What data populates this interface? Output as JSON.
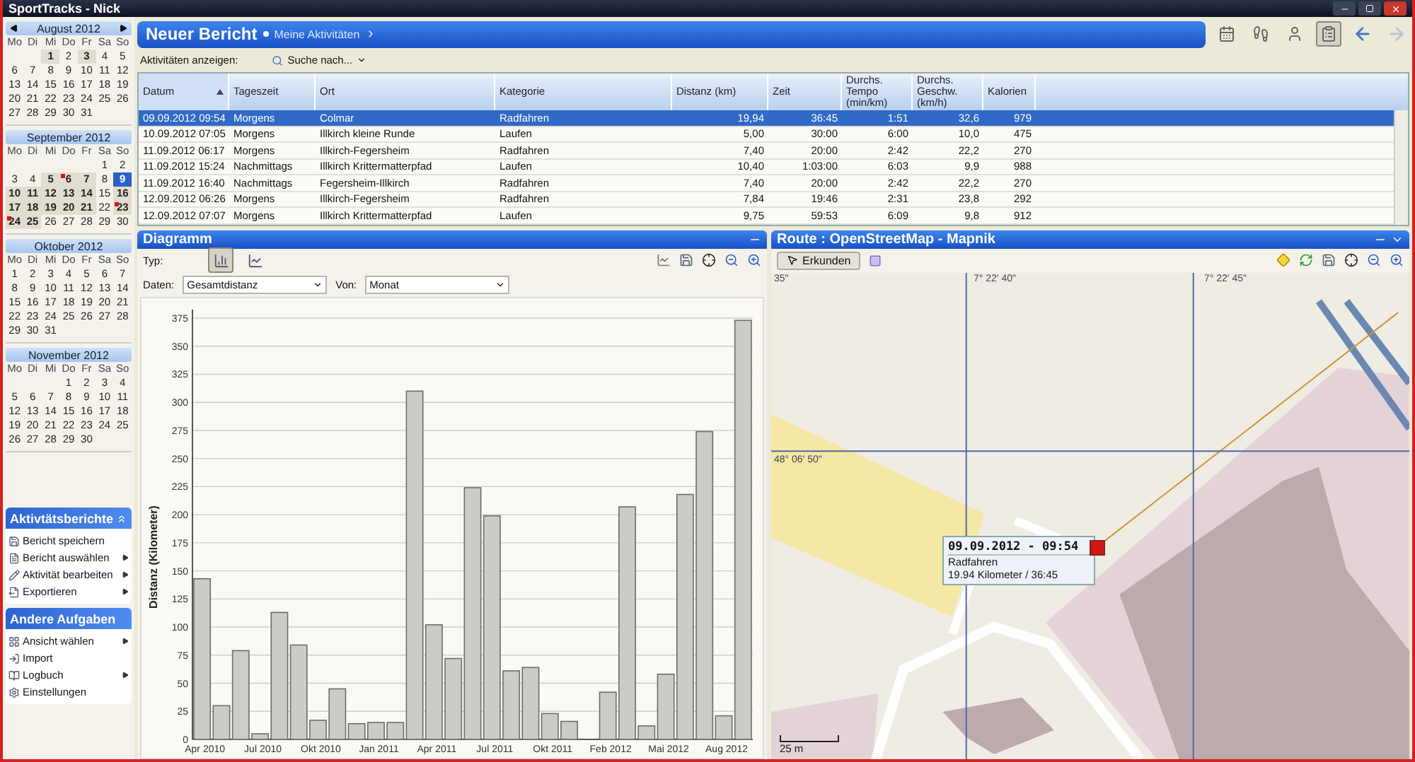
{
  "window": {
    "title": "SportTracks - Nick"
  },
  "calendars": [
    {
      "title": "August 2012",
      "nav_arrows": true,
      "weekdays": [
        "Mo",
        "Di",
        "Mi",
        "Do",
        "Fr",
        "Sa",
        "So"
      ],
      "cells": [
        {
          "kind": "blank"
        },
        {
          "kind": "blank"
        },
        {
          "kind": "day",
          "day": "1",
          "has_activity": true,
          "selected": false,
          "flagged": false
        },
        {
          "kind": "day",
          "day": "2",
          "has_activity": false,
          "selected": false,
          "flagged": false
        },
        {
          "kind": "day",
          "day": "3",
          "has_activity": true,
          "selected": false,
          "flagged": false
        },
        {
          "kind": "day",
          "day": "4",
          "has_activity": false,
          "selected": false,
          "flagged": false
        },
        {
          "kind": "day",
          "day": "5",
          "has_activity": false,
          "selected": false,
          "flagged": false
        },
        {
          "kind": "day",
          "day": "6",
          "has_activity": false,
          "selected": false,
          "flagged": false
        },
        {
          "kind": "day",
          "day": "7",
          "has_activity": false,
          "selected": false,
          "flagged": false
        },
        {
          "kind": "day",
          "day": "8",
          "has_activity": false,
          "selected": false,
          "flagged": false
        },
        {
          "kind": "day",
          "day": "9",
          "has_activity": false,
          "selected": false,
          "flagged": false
        },
        {
          "kind": "day",
          "day": "10",
          "has_activity": false,
          "selected": false,
          "flagged": false
        },
        {
          "kind": "day",
          "day": "11",
          "has_activity": false,
          "selected": false,
          "flagged": false
        },
        {
          "kind": "day",
          "day": "12",
          "has_activity": false,
          "selected": false,
          "flagged": false
        },
        {
          "kind": "day",
          "day": "13",
          "has_activity": false,
          "selected": false,
          "flagged": false
        },
        {
          "kind": "day",
          "day": "14",
          "has_activity": false,
          "selected": false,
          "flagged": false
        },
        {
          "kind": "day",
          "day": "15",
          "has_activity": false,
          "selected": false,
          "flagged": false
        },
        {
          "kind": "day",
          "day": "16",
          "has_activity": false,
          "selected": false,
          "flagged": false
        },
        {
          "kind": "day",
          "day": "17",
          "has_activity": false,
          "selected": false,
          "flagged": false
        },
        {
          "kind": "day",
          "day": "18",
          "has_activity": false,
          "selected": false,
          "flagged": false
        },
        {
          "kind": "day",
          "day": "19",
          "has_activity": false,
          "selected": false,
          "flagged": false
        },
        {
          "kind": "day",
          "day": "20",
          "has_activity": false,
          "selected": false,
          "flagged": false
        },
        {
          "kind": "day",
          "day": "21",
          "has_activity": false,
          "selected": false,
          "flagged": false
        },
        {
          "kind": "day",
          "day": "22",
          "has_activity": false,
          "selected": false,
          "flagged": false
        },
        {
          "kind": "day",
          "day": "23",
          "has_activity": false,
          "selected": false,
          "flagged": false
        },
        {
          "kind": "day",
          "day": "24",
          "has_activity": false,
          "selected": false,
          "flagged": false
        },
        {
          "kind": "day",
          "day": "25",
          "has_activity": false,
          "selected": false,
          "flagged": false
        },
        {
          "kind": "day",
          "day": "26",
          "has_activity": false,
          "selected": false,
          "flagged": false
        },
        {
          "kind": "day",
          "day": "27",
          "has_activity": false,
          "selected": false,
          "flagged": false
        },
        {
          "kind": "day",
          "day": "28",
          "has_activity": false,
          "selected": false,
          "flagged": false
        },
        {
          "kind": "day",
          "day": "29",
          "has_activity": false,
          "selected": false,
          "flagged": false
        },
        {
          "kind": "day",
          "day": "30",
          "has_activity": false,
          "selected": false,
          "flagged": false
        },
        {
          "kind": "day",
          "day": "31",
          "has_activity": false,
          "selected": false,
          "flagged": false
        }
      ]
    },
    {
      "title": "September 2012",
      "nav_arrows": false,
      "weekdays": [
        "Mo",
        "Di",
        "Mi",
        "Do",
        "Fr",
        "Sa",
        "So"
      ],
      "cells": [
        {
          "kind": "blank"
        },
        {
          "kind": "blank"
        },
        {
          "kind": "blank"
        },
        {
          "kind": "blank"
        },
        {
          "kind": "blank"
        },
        {
          "kind": "day",
          "day": "1",
          "has_activity": false,
          "selected": false,
          "flagged": false
        },
        {
          "kind": "day",
          "day": "2",
          "has_activity": false,
          "selected": false,
          "flagged": false
        },
        {
          "kind": "day",
          "day": "3",
          "has_activity": false,
          "selected": false,
          "flagged": false
        },
        {
          "kind": "day",
          "day": "4",
          "has_activity": false,
          "selected": false,
          "flagged": false
        },
        {
          "kind": "day",
          "day": "5",
          "has_activity": true,
          "selected": false,
          "flagged": false
        },
        {
          "kind": "day",
          "day": "6",
          "has_activity": true,
          "selected": false,
          "flagged": true
        },
        {
          "kind": "day",
          "day": "7",
          "has_activity": true,
          "selected": false,
          "flagged": false
        },
        {
          "kind": "day",
          "day": "8",
          "has_activity": false,
          "selected": false,
          "flagged": false
        },
        {
          "kind": "day",
          "day": "9",
          "has_activity": true,
          "selected": true,
          "flagged": false
        },
        {
          "kind": "day",
          "day": "10",
          "has_activity": true,
          "selected": false,
          "flagged": false
        },
        {
          "kind": "day",
          "day": "11",
          "has_activity": true,
          "selected": false,
          "flagged": false
        },
        {
          "kind": "day",
          "day": "12",
          "has_activity": true,
          "selected": false,
          "flagged": false
        },
        {
          "kind": "day",
          "day": "13",
          "has_activity": true,
          "selected": false,
          "flagged": false
        },
        {
          "kind": "day",
          "day": "14",
          "has_activity": true,
          "selected": false,
          "flagged": false
        },
        {
          "kind": "day",
          "day": "15",
          "has_activity": false,
          "selected": false,
          "flagged": false
        },
        {
          "kind": "day",
          "day": "16",
          "has_activity": true,
          "selected": false,
          "flagged": false
        },
        {
          "kind": "day",
          "day": "17",
          "has_activity": true,
          "selected": false,
          "flagged": false
        },
        {
          "kind": "day",
          "day": "18",
          "has_activity": true,
          "selected": false,
          "flagged": false
        },
        {
          "kind": "day",
          "day": "19",
          "has_activity": true,
          "selected": false,
          "flagged": false
        },
        {
          "kind": "day",
          "day": "20",
          "has_activity": true,
          "selected": false,
          "flagged": false
        },
        {
          "kind": "day",
          "day": "21",
          "has_activity": true,
          "selected": false,
          "flagged": false
        },
        {
          "kind": "day",
          "day": "22",
          "has_activity": false,
          "selected": false,
          "flagged": false
        },
        {
          "kind": "day",
          "day": "23",
          "has_activity": true,
          "selected": false,
          "flagged": true
        },
        {
          "kind": "day",
          "day": "24",
          "has_activity": true,
          "selected": false,
          "flagged": true
        },
        {
          "kind": "day",
          "day": "25",
          "has_activity": true,
          "selected": false,
          "flagged": false
        },
        {
          "kind": "day",
          "day": "26",
          "has_activity": false,
          "selected": false,
          "flagged": false
        },
        {
          "kind": "day",
          "day": "27",
          "has_activity": false,
          "selected": false,
          "flagged": false
        },
        {
          "kind": "day",
          "day": "28",
          "has_activity": false,
          "selected": false,
          "flagged": false
        },
        {
          "kind": "day",
          "day": "29",
          "has_activity": false,
          "selected": false,
          "flagged": false
        },
        {
          "kind": "day",
          "day": "30",
          "has_activity": false,
          "selected": false,
          "flagged": false
        }
      ]
    },
    {
      "title": "Oktober 2012",
      "nav_arrows": false,
      "weekdays": [
        "Mo",
        "Di",
        "Mi",
        "Do",
        "Fr",
        "Sa",
        "So"
      ],
      "cells": [
        {
          "kind": "day",
          "day": "1",
          "has_activity": false,
          "selected": false,
          "flagged": false
        },
        {
          "kind": "day",
          "day": "2",
          "has_activity": false,
          "selected": false,
          "flagged": false
        },
        {
          "kind": "day",
          "day": "3",
          "has_activity": false,
          "selected": false,
          "flagged": false
        },
        {
          "kind": "day",
          "day": "4",
          "has_activity": false,
          "selected": false,
          "flagged": false
        },
        {
          "kind": "day",
          "day": "5",
          "has_activity": false,
          "selected": false,
          "flagged": false
        },
        {
          "kind": "day",
          "day": "6",
          "has_activity": false,
          "selected": false,
          "flagged": false
        },
        {
          "kind": "day",
          "day": "7",
          "has_activity": false,
          "selected": false,
          "flagged": false
        },
        {
          "kind": "day",
          "day": "8",
          "has_activity": false,
          "selected": false,
          "flagged": false
        },
        {
          "kind": "day",
          "day": "9",
          "has_activity": false,
          "selected": false,
          "flagged": false
        },
        {
          "kind": "day",
          "day": "10",
          "has_activity": false,
          "selected": false,
          "flagged": false
        },
        {
          "kind": "day",
          "day": "11",
          "has_activity": false,
          "selected": false,
          "flagged": false
        },
        {
          "kind": "day",
          "day": "12",
          "has_activity": false,
          "selected": false,
          "flagged": false
        },
        {
          "kind": "day",
          "day": "13",
          "has_activity": false,
          "selected": false,
          "flagged": false
        },
        {
          "kind": "day",
          "day": "14",
          "has_activity": false,
          "selected": false,
          "flagged": false
        },
        {
          "kind": "day",
          "day": "15",
          "has_activity": false,
          "selected": false,
          "flagged": false
        },
        {
          "kind": "day",
          "day": "16",
          "has_activity": false,
          "selected": false,
          "flagged": false
        },
        {
          "kind": "day",
          "day": "17",
          "has_activity": false,
          "selected": false,
          "flagged": false
        },
        {
          "kind": "day",
          "day": "18",
          "has_activity": false,
          "selected": false,
          "flagged": false
        },
        {
          "kind": "day",
          "day": "19",
          "has_activity": false,
          "selected": false,
          "flagged": false
        },
        {
          "kind": "day",
          "day": "20",
          "has_activity": false,
          "selected": false,
          "flagged": false
        },
        {
          "kind": "day",
          "day": "21",
          "has_activity": false,
          "selected": false,
          "flagged": false
        },
        {
          "kind": "day",
          "day": "22",
          "has_activity": false,
          "selected": false,
          "flagged": false
        },
        {
          "kind": "day",
          "day": "23",
          "has_activity": false,
          "selected": false,
          "flagged": false
        },
        {
          "kind": "day",
          "day": "24",
          "has_activity": false,
          "selected": false,
          "flagged": false
        },
        {
          "kind": "day",
          "day": "25",
          "has_activity": false,
          "selected": false,
          "flagged": false
        },
        {
          "kind": "day",
          "day": "26",
          "has_activity": false,
          "selected": false,
          "flagged": false
        },
        {
          "kind": "day",
          "day": "27",
          "has_activity": false,
          "selected": false,
          "flagged": false
        },
        {
          "kind": "day",
          "day": "28",
          "has_activity": false,
          "selected": false,
          "flagged": false
        },
        {
          "kind": "day",
          "day": "29",
          "has_activity": false,
          "selected": false,
          "flagged": false
        },
        {
          "kind": "day",
          "day": "30",
          "has_activity": false,
          "selected": false,
          "flagged": false
        },
        {
          "kind": "day",
          "day": "31",
          "has_activity": false,
          "selected": false,
          "flagged": false
        }
      ]
    },
    {
      "title": "November 2012",
      "nav_arrows": false,
      "weekdays": [
        "Mo",
        "Di",
        "Mi",
        "Do",
        "Fr",
        "Sa",
        "So"
      ],
      "cells": [
        {
          "kind": "blank"
        },
        {
          "kind": "blank"
        },
        {
          "kind": "blank"
        },
        {
          "kind": "day",
          "day": "1",
          "has_activity": false,
          "selected": false,
          "flagged": false
        },
        {
          "kind": "day",
          "day": "2",
          "has_activity": false,
          "selected": false,
          "flagged": false
        },
        {
          "kind": "day",
          "day": "3",
          "has_activity": false,
          "selected": false,
          "flagged": false
        },
        {
          "kind": "day",
          "day": "4",
          "has_activity": false,
          "selected": false,
          "flagged": false
        },
        {
          "kind": "day",
          "day": "5",
          "has_activity": false,
          "selected": false,
          "flagged": false
        },
        {
          "kind": "day",
          "day": "6",
          "has_activity": false,
          "selected": false,
          "flagged": false
        },
        {
          "kind": "day",
          "day": "7",
          "has_activity": false,
          "selected": false,
          "flagged": false
        },
        {
          "kind": "day",
          "day": "8",
          "has_activity": false,
          "selected": false,
          "flagged": false
        },
        {
          "kind": "day",
          "day": "9",
          "has_activity": false,
          "selected": false,
          "flagged": false
        },
        {
          "kind": "day",
          "day": "10",
          "has_activity": false,
          "selected": false,
          "flagged": false
        },
        {
          "kind": "day",
          "day": "11",
          "has_activity": false,
          "selected": false,
          "flagged": false
        },
        {
          "kind": "day",
          "day": "12",
          "has_activity": false,
          "selected": false,
          "flagged": false
        },
        {
          "kind": "day",
          "day": "13",
          "has_activity": false,
          "selected": false,
          "flagged": false
        },
        {
          "kind": "day",
          "day": "14",
          "has_activity": false,
          "selected": false,
          "flagged": false
        },
        {
          "kind": "day",
          "day": "15",
          "has_activity": false,
          "selected": false,
          "flagged": false
        },
        {
          "kind": "day",
          "day": "16",
          "has_activity": false,
          "selected": false,
          "flagged": false
        },
        {
          "kind": "day",
          "day": "17",
          "has_activity": false,
          "selected": false,
          "flagged": false
        },
        {
          "kind": "day",
          "day": "18",
          "has_activity": false,
          "selected": false,
          "flagged": false
        },
        {
          "kind": "day",
          "day": "19",
          "has_activity": false,
          "selected": false,
          "flagged": false
        },
        {
          "kind": "day",
          "day": "20",
          "has_activity": false,
          "selected": false,
          "flagged": false
        },
        {
          "kind": "day",
          "day": "21",
          "has_activity": false,
          "selected": false,
          "flagged": false
        },
        {
          "kind": "day",
          "day": "22",
          "has_activity": false,
          "selected": false,
          "flagged": false
        },
        {
          "kind": "day",
          "day": "23",
          "has_activity": false,
          "selected": false,
          "flagged": false
        },
        {
          "kind": "day",
          "day": "24",
          "has_activity": false,
          "selected": false,
          "flagged": false
        },
        {
          "kind": "day",
          "day": "25",
          "has_activity": false,
          "selected": false,
          "flagged": false
        },
        {
          "kind": "day",
          "day": "26",
          "has_activity": false,
          "selected": false,
          "flagged": false
        },
        {
          "kind": "day",
          "day": "27",
          "has_activity": false,
          "selected": false,
          "flagged": false
        },
        {
          "kind": "day",
          "day": "28",
          "has_activity": false,
          "selected": false,
          "flagged": false
        },
        {
          "kind": "day",
          "day": "29",
          "has_activity": false,
          "selected": false,
          "flagged": false
        },
        {
          "kind": "day",
          "day": "30",
          "has_activity": false,
          "selected": false,
          "flagged": false
        }
      ]
    }
  ],
  "task_panels": [
    {
      "title": "Aktivtätsberichte",
      "collapsible": true,
      "items": [
        {
          "label": "Bericht speichern",
          "kind": "save",
          "submenu": false
        },
        {
          "label": "Bericht auswählen",
          "kind": "report",
          "submenu": true
        },
        {
          "label": "Aktivität bearbeiten",
          "kind": "edit",
          "submenu": true
        },
        {
          "label": "Exportieren",
          "kind": "export",
          "submenu": true
        }
      ]
    },
    {
      "title": "Andere Aufgaben",
      "collapsible": false,
      "items": [
        {
          "label": "Ansicht wählen",
          "kind": "view",
          "submenu": true
        },
        {
          "label": "Import",
          "kind": "import",
          "submenu": false
        },
        {
          "label": "Logbuch",
          "kind": "logbook",
          "submenu": true
        },
        {
          "label": "Einstellungen",
          "kind": "settings",
          "submenu": false
        }
      ]
    }
  ],
  "report": {
    "title": "Neuer Bericht",
    "breadcrumb": "Meine Aktivitäten",
    "views": [
      {
        "kind": "calendar",
        "selected": false
      },
      {
        "kind": "shoe",
        "selected": false
      },
      {
        "kind": "athlete",
        "selected": false
      },
      {
        "kind": "report",
        "selected": true
      }
    ],
    "navigation": [
      {
        "kind": "back",
        "disabled": false
      },
      {
        "kind": "forward",
        "disabled": true
      }
    ],
    "filter_label": "Aktivitäten anzeigen:",
    "search_button": "Suche nach..."
  },
  "table": {
    "columns": [
      {
        "label": "Datum",
        "sorted": true,
        "numeric": false
      },
      {
        "label": "Tageszeit",
        "sorted": false,
        "numeric": false
      },
      {
        "label": "Ort",
        "sorted": false,
        "numeric": false
      },
      {
        "label": "Kategorie",
        "sorted": false,
        "numeric": false
      },
      {
        "label": "Distanz (km)",
        "sorted": false,
        "numeric": true
      },
      {
        "label": "Zeit",
        "sorted": false,
        "numeric": true
      },
      {
        "label": "Durchs.\nTempo\n(min/km)",
        "sorted": false,
        "numeric": true
      },
      {
        "label": "Durchs.\nGeschw.\n(km/h)",
        "sorted": false,
        "numeric": true
      },
      {
        "label": "Kalorien",
        "sorted": false,
        "numeric": true
      }
    ],
    "rows": [
      {
        "selected": true,
        "cells": [
          "09.09.2012 09:54",
          "Morgens",
          "Colmar",
          "Radfahren",
          "19,94",
          "36:45",
          "1:51",
          "32,6",
          "979"
        ]
      },
      {
        "selected": false,
        "cells": [
          "10.09.2012 07:05",
          "Morgens",
          "Illkirch kleine Runde",
          "Laufen",
          "5,00",
          "30:00",
          "6:00",
          "10,0",
          "475"
        ]
      },
      {
        "selected": false,
        "cells": [
          "11.09.2012 06:17",
          "Morgens",
          "Illkirch-Fegersheim",
          "Radfahren",
          "7,40",
          "20:00",
          "2:42",
          "22,2",
          "270"
        ]
      },
      {
        "selected": false,
        "cells": [
          "11.09.2012 15:24",
          "Nachmittags",
          "Illkirch Krittermatterpfad",
          "Laufen",
          "10,40",
          "1:03:00",
          "6:03",
          "9,9",
          "988"
        ]
      },
      {
        "selected": false,
        "cells": [
          "11.09.2012 16:40",
          "Nachmittags",
          "Fegersheim-Illkirch",
          "Radfahren",
          "7,40",
          "20:00",
          "2:42",
          "22,2",
          "270"
        ]
      },
      {
        "selected": false,
        "cells": [
          "12.09.2012 06:26",
          "Morgens",
          "Illkirch-Fegersheim",
          "Radfahren",
          "7,84",
          "19:46",
          "2:31",
          "23,8",
          "292"
        ]
      },
      {
        "selected": false,
        "cells": [
          "12.09.2012 07:07",
          "Morgens",
          "Illkirch Krittermatterpfad",
          "Laufen",
          "9,75",
          "59:53",
          "6:09",
          "9,8",
          "912"
        ]
      }
    ]
  },
  "diagram": {
    "title": "Diagramm",
    "type_label": "Typ:",
    "chart_types": [
      {
        "kind": "bar",
        "selected": true
      },
      {
        "kind": "line",
        "selected": false
      }
    ],
    "data_label": "Daten:",
    "data_value": "Gesamtdistanz",
    "from_label": "Von:",
    "from_value": "Monat",
    "chart_data": {
      "type": "bar",
      "ylabel": "Distanz (Kilometer)",
      "ylim": [
        0,
        375
      ],
      "yticks": [
        0,
        25,
        50,
        75,
        100,
        125,
        150,
        175,
        200,
        225,
        250,
        275,
        300,
        325,
        350,
        375
      ],
      "grid": true,
      "categories": [
        "Apr 2010",
        null,
        null,
        "Jul 2010",
        null,
        null,
        "Okt 2010",
        null,
        null,
        "Jan 2011",
        null,
        null,
        "Apr 2011",
        null,
        null,
        "Jul 2011",
        null,
        null,
        "Okt 2011",
        null,
        null,
        "Feb 2012",
        null,
        null,
        "Mai 2012",
        null,
        null,
        "Aug 2012",
        null
      ],
      "values": [
        143,
        30,
        79,
        5,
        113,
        84,
        17,
        45,
        14,
        15,
        15,
        310,
        102,
        72,
        224,
        199,
        61,
        64,
        23,
        16,
        null,
        42,
        207,
        12,
        58,
        218,
        274,
        21,
        373
      ]
    }
  },
  "map": {
    "title": "Route : OpenStreetMap - Mapnik",
    "explore_button": "Erkunden",
    "grid_labels": [
      "35\"",
      "7° 22' 40\"",
      "7° 22' 45\"",
      "48° 06' 50\""
    ],
    "popup": {
      "title": "09.09.2012 - 09:54",
      "category": "Radfahren",
      "summary": "19.94 Kilometer / 36:45"
    },
    "scale": "25 m"
  }
}
